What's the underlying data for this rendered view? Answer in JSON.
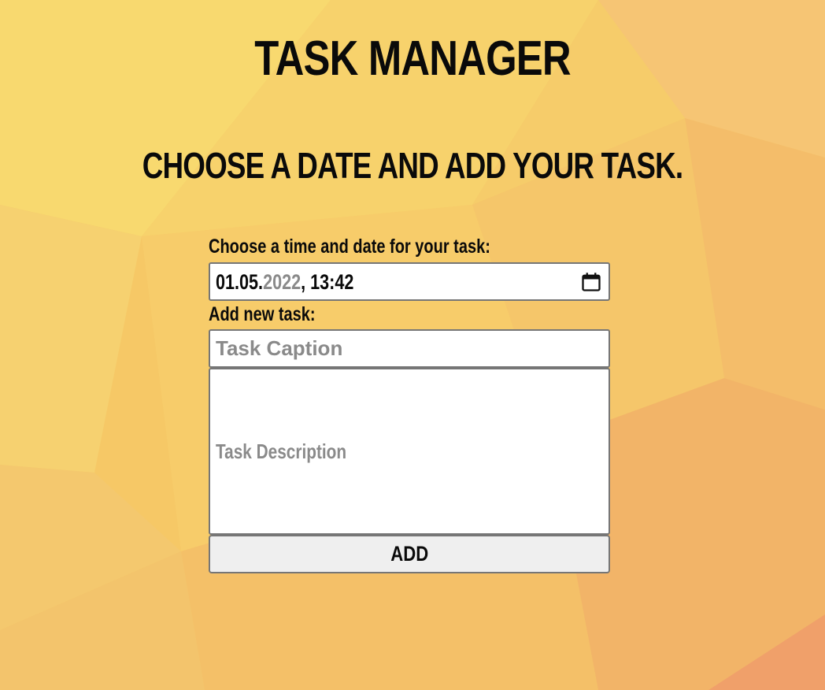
{
  "header": {
    "title": "TASK MANAGER",
    "subtitle": "CHOOSE A DATE AND ADD YOUR TASK."
  },
  "form": {
    "date_label": "Choose a time and date for your task:",
    "date_value": {
      "day_month": "01.05.",
      "year": "2022",
      "time": ", 13:42"
    },
    "calendar_icon": "calendar-icon",
    "task_label": "Add new task:",
    "caption_placeholder": "Task Caption",
    "description_placeholder": "Task Description",
    "add_button_label": "ADD"
  },
  "colors": {
    "background": "#f6c866",
    "text": "#0a0a0a",
    "placeholder": "#8a8a8a",
    "input_border": "#767676",
    "button_bg": "#efefef"
  }
}
